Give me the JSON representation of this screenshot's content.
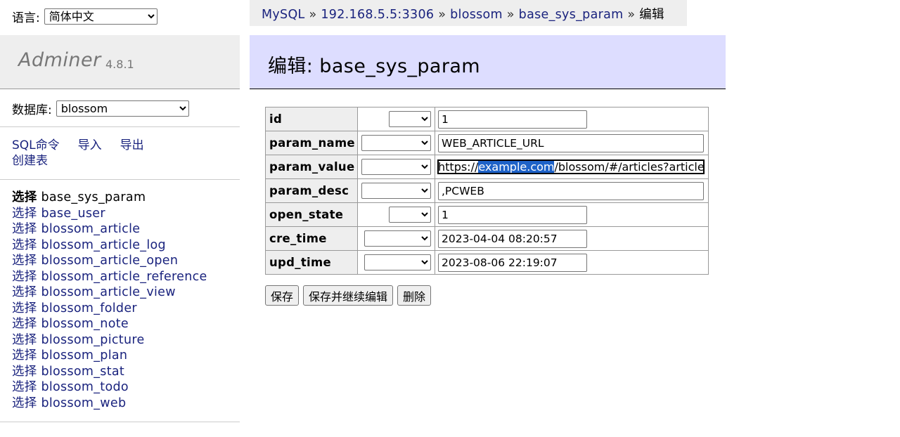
{
  "menu": {
    "language_label": "语言:",
    "language_selected": "简体中文",
    "app_name": "Adminer",
    "app_version": "4.8.1",
    "database_label": "数据库:",
    "database_selected": "blossom",
    "commands": [
      "SQL命令",
      "导入",
      "导出"
    ],
    "create_table": "创建表",
    "select_prefix": "选择",
    "tables": [
      "base_sys_param",
      "base_user",
      "blossom_article",
      "blossom_article_log",
      "blossom_article_open",
      "blossom_article_reference",
      "blossom_article_view",
      "blossom_folder",
      "blossom_note",
      "blossom_picture",
      "blossom_plan",
      "blossom_stat",
      "blossom_todo",
      "blossom_web"
    ],
    "active_table": "base_sys_param"
  },
  "breadcrumb": {
    "items": [
      "MySQL",
      "192.168.5.5:3306",
      "blossom",
      "base_sys_param"
    ],
    "current": "编辑",
    "separator": "»"
  },
  "page_title": "编辑: base_sys_param",
  "fields": [
    {
      "name": "id",
      "value": "1"
    },
    {
      "name": "param_name",
      "value": "WEB_ARTICLE_URL"
    },
    {
      "name": "param_value",
      "value_before": "https://",
      "value_selected": "example.com",
      "value_after": "/blossom/#/articles?articleId="
    },
    {
      "name": "param_desc",
      "value": ",PCWEB"
    },
    {
      "name": "open_state",
      "value": "1"
    },
    {
      "name": "cre_time",
      "value": "2023-04-04 08:20:57"
    },
    {
      "name": "upd_time",
      "value": "2023-08-06 22:19:07"
    }
  ],
  "buttons": {
    "save": "保存",
    "save_continue": "保存并继续编辑",
    "delete": "删除"
  },
  "colors": {
    "link": "#1a237e",
    "heading_bg": "#ddddff",
    "panel_bg": "#eeeeee",
    "selection": "#1e62c8"
  }
}
